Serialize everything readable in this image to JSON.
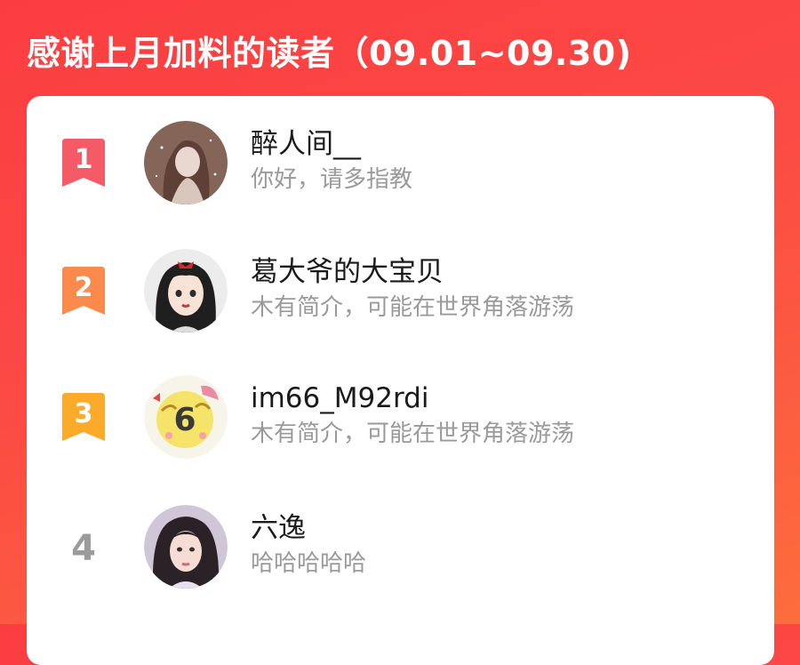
{
  "header": {
    "title": "感谢上月加料的读者（09.01~09.30)"
  },
  "readers": [
    {
      "rank": "1",
      "name": "醉人间__",
      "bio": "你好，请多指教",
      "badge_color": "#f45b66"
    },
    {
      "rank": "2",
      "name": "葛大爷的大宝贝",
      "bio": "木有简介，可能在世界角落游荡",
      "badge_color": "#fb8a4c"
    },
    {
      "rank": "3",
      "name": "im66_M92rdi",
      "bio": "木有简介，可能在世界角落游荡",
      "badge_color": "#fbaa2a"
    },
    {
      "rank": "4",
      "name": "六逸",
      "bio": "哈哈哈哈哈"
    }
  ],
  "colors": {
    "background_top": "#fb3d42",
    "background_bottom": "#fd6d3c",
    "card": "#ffffff",
    "name_text": "#1a1a1a",
    "bio_text": "#9a9a9a",
    "rank4_text": "#9b9b9b"
  }
}
